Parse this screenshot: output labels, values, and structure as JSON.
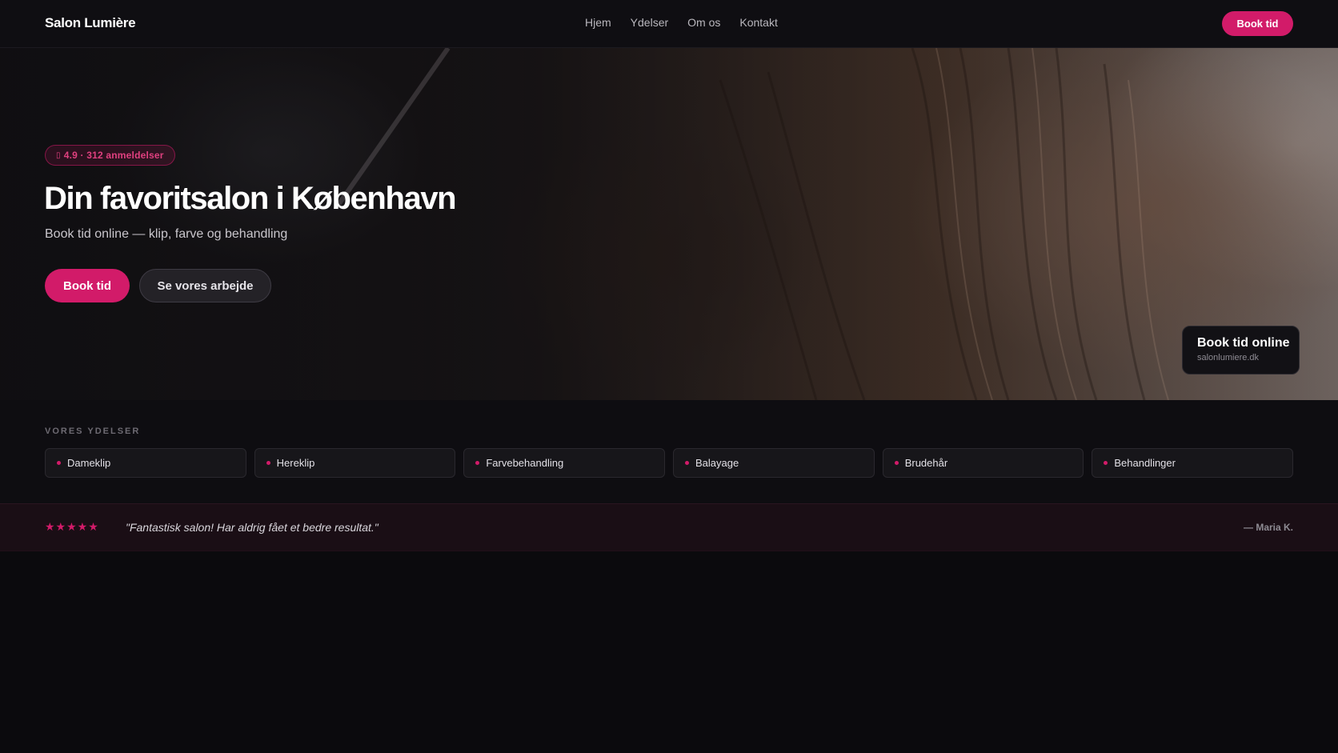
{
  "nav": {
    "brand": "Salon Lumière",
    "links": [
      "Hjem",
      "Ydelser",
      "Om os",
      "Kontakt"
    ],
    "cta": "Book tid"
  },
  "hero": {
    "rating": "4.9 · 312 anmeldelser",
    "rating_icon": "star-icon",
    "title": "Din favoritsalon i København",
    "subtitle": "Book tid online — klip, farve og behandling",
    "primary_button": "Book tid",
    "secondary_button": "Se vores arbejde",
    "card": {
      "title": "Book tid online",
      "url": "salonlumiere.dk"
    }
  },
  "services": {
    "heading": "VORES YDELSER",
    "items": [
      "Dameklip",
      "Hereklip",
      "Farvebehandling",
      "Balayage",
      "Brudehår",
      "Behandlinger"
    ]
  },
  "testimonial": {
    "stars": "★★★★★",
    "rating_value": 5,
    "quote": "\"Fantastisk salon! Har aldrig fået et bedre resultat.\"",
    "author": "— Maria K."
  },
  "colors": {
    "accent": "#d21b69",
    "background": "#0b0a0d"
  }
}
